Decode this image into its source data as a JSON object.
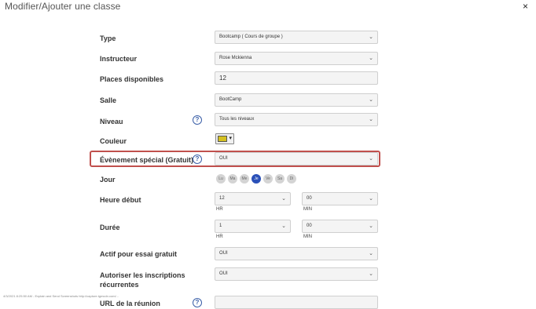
{
  "modal": {
    "title": "Modifier/Ajouter une classe",
    "close_glyph": "×"
  },
  "fields": {
    "type": {
      "label": "Type",
      "value": "Bootcamp ( Cours de groupe )"
    },
    "instructeur": {
      "label": "Instructeur",
      "value": "Rose Mckienna"
    },
    "places": {
      "label": "Places disponibles",
      "value": "12"
    },
    "salle": {
      "label": "Salle",
      "value": "BootCamp"
    },
    "niveau": {
      "label": "Niveau",
      "value": "Tous les niveaux"
    },
    "couleur": {
      "label": "Couleur",
      "color": "#d4c020"
    },
    "evenement": {
      "label": "Évènement spécial (Gratuit)",
      "value": "OUI"
    },
    "jour": {
      "label": "Jour",
      "days": [
        "Lu",
        "Ma",
        "Me",
        "Je",
        "Ve",
        "Sa",
        "Di"
      ],
      "active_day": "Je"
    },
    "heure_debut": {
      "label": "Heure début",
      "hour": "12",
      "hour_unit": "HR",
      "minute": "00",
      "minute_unit": "MIN"
    },
    "duree": {
      "label": "Durée",
      "hour": "1",
      "hour_unit": "HR",
      "minute": "00",
      "minute_unit": "MIN"
    },
    "essai": {
      "label": "Actif pour essai gratuit",
      "value": "OUI"
    },
    "recurrentes": {
      "label": "Autoriser les inscriptions récurrentes",
      "value": "OUI"
    },
    "url": {
      "label": "URL de la réunion",
      "value": ""
    }
  },
  "help_glyph": "?",
  "chevron_glyph": "⌄",
  "footer_note": "4/3/2021 8:25:50 AM - Explain and Send Screenshots http://capture.tgmcdn.com/..."
}
